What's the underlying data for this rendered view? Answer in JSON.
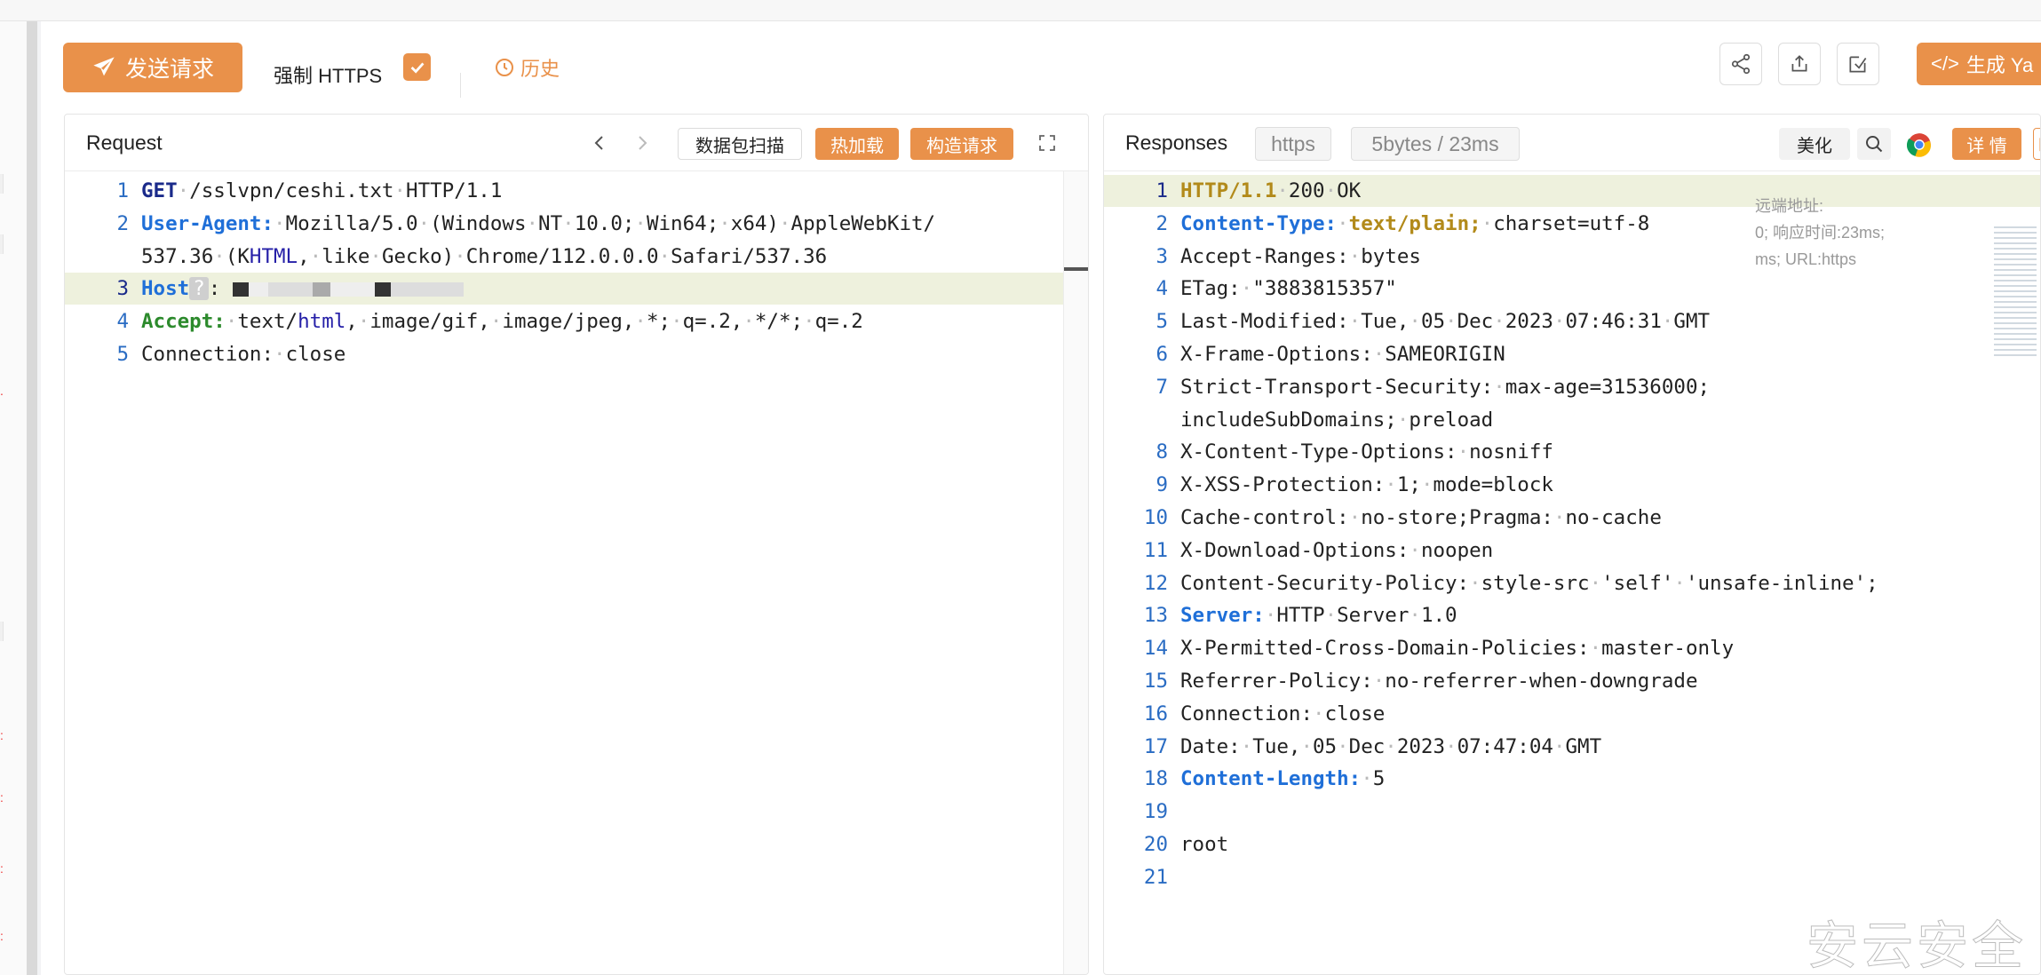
{
  "toolbar": {
    "send_label": "发送请求",
    "force_https_label": "强制 HTTPS",
    "force_https_checked": true,
    "history_label": "历史",
    "generate_label": "生成 Ya",
    "accent_color": "#e9914a"
  },
  "request": {
    "title": "Request",
    "scan_label": "数据包扫描",
    "hotload_label": "热加载",
    "build_label": "构造请求",
    "lines": [
      {
        "n": "1",
        "text": "GET /sslvpn/ceshi.txt HTTP/1.1"
      },
      {
        "n": "2",
        "text": "User-Agent: Mozilla/5.0 (Windows NT 10.0; Win64; x64) AppleWebKit/"
      },
      {
        "n": "",
        "text": "537.36 (KHTML, like Gecko) Chrome/112.0.0.0 Safari/537.36"
      },
      {
        "n": "3",
        "text": "Host ? :"
      },
      {
        "n": "4",
        "text": "Accept: text/html, image/gif, image/jpeg, *; q=.2, */*; q=.2"
      },
      {
        "n": "5",
        "text": "Connection: close"
      }
    ]
  },
  "response": {
    "title": "Responses",
    "protocol_tag": "https",
    "stats_tag": "5bytes / 23ms",
    "beautify_label": "美化",
    "detail_label": "详 情",
    "overlay_lines": [
      "远端地址:",
      "0; 响应时间:23ms;",
      "ms; URL:https"
    ],
    "lines": [
      {
        "n": "1",
        "text": "HTTP/1.1 200 OK"
      },
      {
        "n": "2",
        "text": "Content-Type: text/plain; charset=utf-8"
      },
      {
        "n": "3",
        "text": "Accept-Ranges: bytes"
      },
      {
        "n": "4",
        "text": "ETag: \"3883815357\""
      },
      {
        "n": "5",
        "text": "Last-Modified: Tue, 05 Dec 2023 07:46:31 GMT"
      },
      {
        "n": "6",
        "text": "X-Frame-Options: SAMEORIGIN"
      },
      {
        "n": "7",
        "text": "Strict-Transport-Security: max-age=31536000;"
      },
      {
        "n": "",
        "text": "includeSubDomains; preload"
      },
      {
        "n": "8",
        "text": "X-Content-Type-Options: nosniff"
      },
      {
        "n": "9",
        "text": "X-XSS-Protection: 1; mode=block"
      },
      {
        "n": "10",
        "text": "Cache-control: no-store;Pragma: no-cache"
      },
      {
        "n": "11",
        "text": "X-Download-Options: noopen"
      },
      {
        "n": "12",
        "text": "Content-Security-Policy: style-src 'self' 'unsafe-inline';"
      },
      {
        "n": "13",
        "text": "Server: HTTP Server 1.0"
      },
      {
        "n": "14",
        "text": "X-Permitted-Cross-Domain-Policies: master-only"
      },
      {
        "n": "15",
        "text": "Referrer-Policy: no-referrer-when-downgrade"
      },
      {
        "n": "16",
        "text": "Connection: close"
      },
      {
        "n": "17",
        "text": "Date: Tue, 05 Dec 2023 07:47:04 GMT"
      },
      {
        "n": "18",
        "text": "Content-Length: 5"
      },
      {
        "n": "19",
        "text": ""
      },
      {
        "n": "20",
        "text": "root"
      },
      {
        "n": "21",
        "text": ""
      }
    ]
  },
  "watermark": "安云安全"
}
